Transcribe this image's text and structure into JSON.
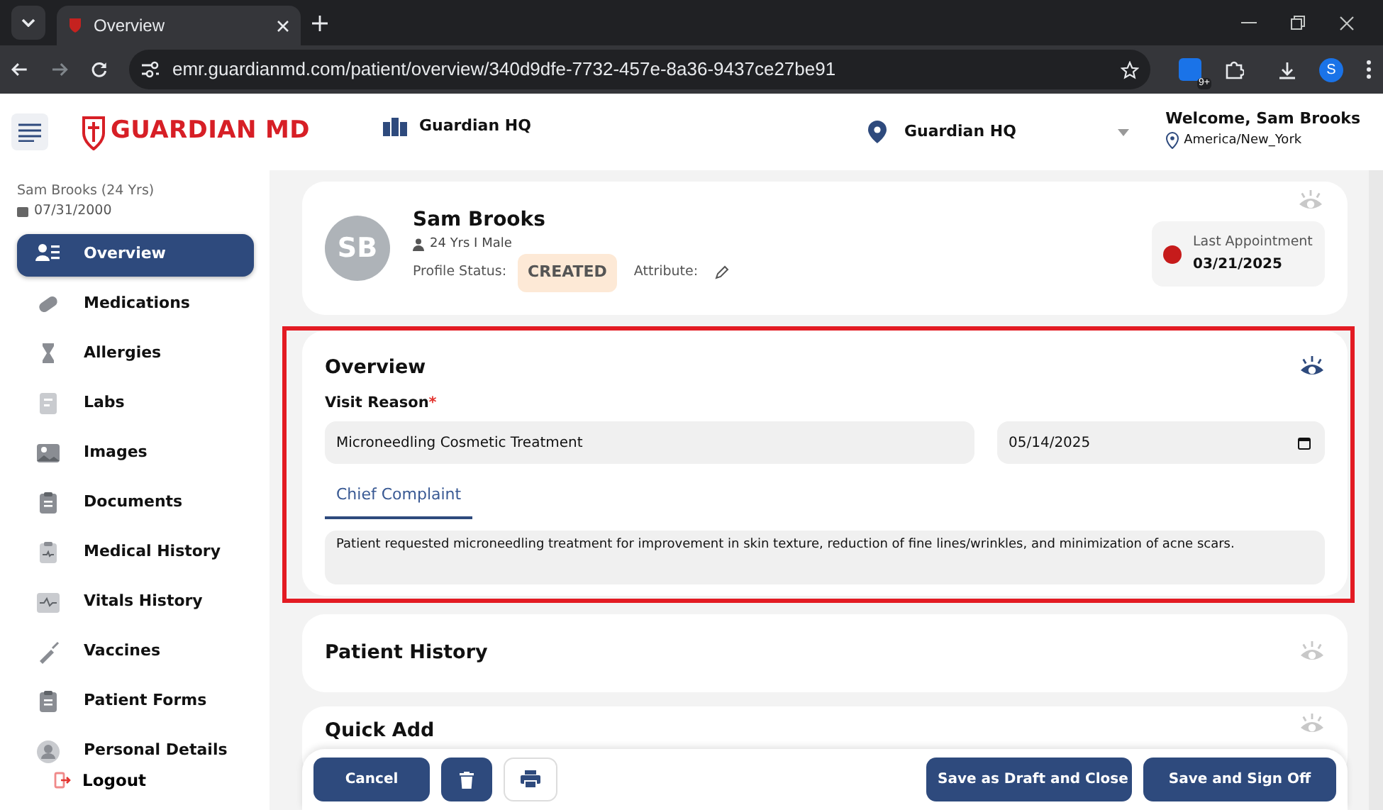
{
  "browser": {
    "tab_title": "Overview",
    "url": "emr.guardianmd.com/patient/overview/340d9dfe-7732-457e-8a36-9437ce27be91",
    "extension_badge": "9+",
    "profile_initial": "S"
  },
  "header": {
    "logo": "GUARDIAN MD",
    "facility": "Guardian HQ",
    "location": "Guardian HQ",
    "welcome": "Welcome, Sam Brooks",
    "timezone": "America/New_York"
  },
  "sidebar": {
    "patient": "Sam Brooks (24 Yrs)",
    "dob": "07/31/2000",
    "items": [
      {
        "label": "Overview",
        "selected": true
      },
      {
        "label": "Medications",
        "selected": false
      },
      {
        "label": "Allergies",
        "selected": false
      },
      {
        "label": "Labs",
        "selected": false
      },
      {
        "label": "Images",
        "selected": false
      },
      {
        "label": "Documents",
        "selected": false
      },
      {
        "label": "Medical History",
        "selected": false
      },
      {
        "label": "Vitals History",
        "selected": false
      },
      {
        "label": "Vaccines",
        "selected": false
      },
      {
        "label": "Patient Forms",
        "selected": false
      },
      {
        "label": "Personal Details",
        "selected": false
      }
    ],
    "logout": "Logout"
  },
  "profile": {
    "initials": "SB",
    "name": "Sam Brooks",
    "demographics": "24 Yrs I Male",
    "status_label": "Profile Status:",
    "status": "CREATED",
    "attribute_label": "Attribute:",
    "last_appointment_label": "Last Appointment",
    "last_appointment": "03/21/2025",
    "eye_active": false
  },
  "overview": {
    "title": "Overview",
    "eye_active": true,
    "highlighted": true,
    "visit_reason_label": "Visit Reason",
    "required": true,
    "required_mark": "*",
    "visit_reason": "Microneedling Cosmetic Treatment",
    "date": "05/14/2025",
    "tabs": [
      {
        "label": "Chief Complaint",
        "selected": true
      }
    ],
    "complaint": "Patient requested microneedling treatment for improvement in skin texture, reduction of fine lines/wrinkles, and minimization of acne scars."
  },
  "sections": [
    {
      "title": "Patient History",
      "eye_active": false
    },
    {
      "title": "Quick Add",
      "eye_active": false
    }
  ],
  "footer": {
    "left_buttons": [
      {
        "kind": "primary",
        "label": "Cancel"
      },
      {
        "kind": "delete"
      },
      {
        "kind": "print"
      }
    ],
    "right_buttons": [
      {
        "kind": "primary",
        "label": "Save as Draft and Close"
      },
      {
        "kind": "primary",
        "label": "Save and Sign Off"
      }
    ]
  }
}
